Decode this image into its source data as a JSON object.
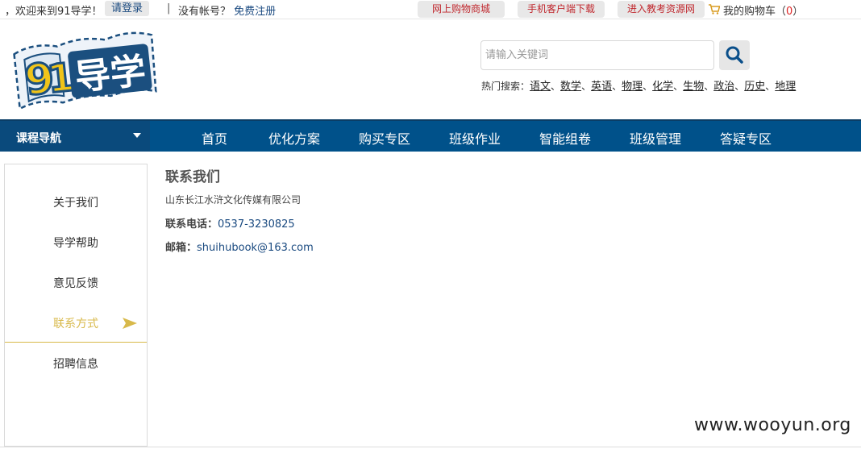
{
  "topbar": {
    "welcome": "，欢迎来到91导学！",
    "login": "请登录",
    "separator": "|",
    "no_account": "没有帐号？",
    "register": "免费注册",
    "links": [
      "网上购物商城",
      "手机客户端下载",
      "进入教考资源网"
    ],
    "cart_label": "我的购物车（",
    "cart_count": "0",
    "cart_close": "）"
  },
  "header": {
    "logo_text": "91导学",
    "search_placeholder": "请输入关键词",
    "hot_label": "热门搜索：",
    "hot_terms": [
      "语文",
      "数学",
      "英语",
      "物理",
      "化学",
      "生物",
      "政治",
      "历史",
      "地理"
    ]
  },
  "nav": {
    "course_nav": "课程导航",
    "items": [
      "首页",
      "优化方案",
      "购买专区",
      "班级作业",
      "智能组卷",
      "班级管理",
      "答疑专区"
    ]
  },
  "sidebar": {
    "items": [
      "关于我们",
      "导学帮助",
      "意见反馈",
      "联系方式",
      "招聘信息"
    ],
    "active_index": 3
  },
  "content": {
    "title": "联系我们",
    "company": "山东长江水浒文化传媒有限公司",
    "phone_label": "联系电话：",
    "phone": "0537-3230825",
    "email_label": "邮箱：",
    "email": "shuihubook@163.com"
  },
  "watermark": "www.wooyun.org",
  "colors": {
    "nav_bg": "#00518a",
    "active_accent": "#d8b94a",
    "link_blue": "#1a4a80",
    "topbar_link_red": "#c0272d"
  }
}
